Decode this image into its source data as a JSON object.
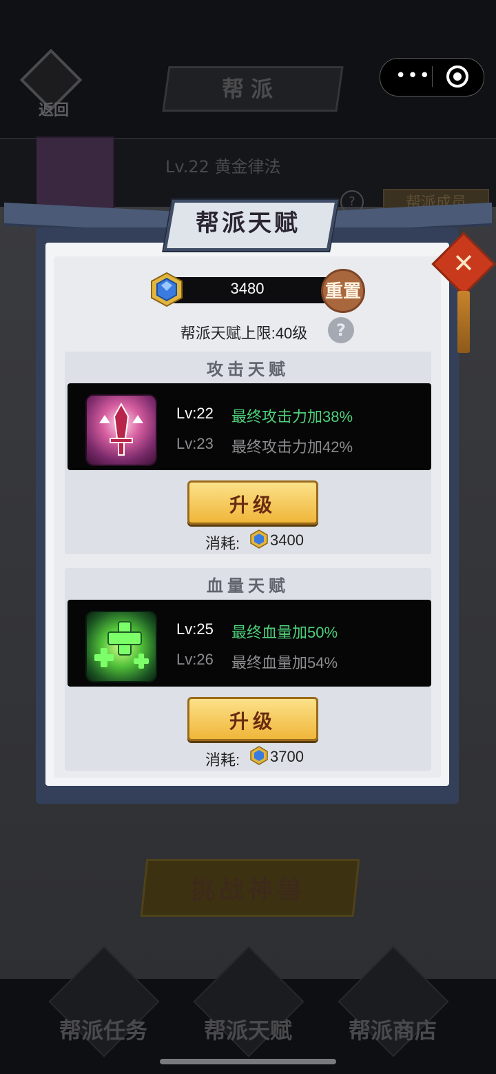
{
  "header": {
    "back_label": "返回",
    "title": "帮派",
    "menu_icon": "more-dots-icon",
    "close_icon": "target-close-icon"
  },
  "guild": {
    "name": "Lv.22  黄金律法",
    "members_label": "帮派成员"
  },
  "background": {
    "challenge_label": "挑战神兽",
    "nav": [
      "帮派任务",
      "帮派天赋",
      "帮派商店"
    ]
  },
  "dialog": {
    "title": "帮派天赋",
    "currency_value": "3480",
    "reset_label": "重置",
    "limit_text": "帮派天赋上限:40级",
    "help_label": "?",
    "close_label": "✕",
    "sections": [
      {
        "header": "攻击天赋",
        "current_level": "Lv:22",
        "current_desc": "最终攻击力加38%",
        "next_level": "Lv:23",
        "next_desc": "最终攻击力加42%",
        "upgrade_label": "升级",
        "cost_label": "消耗:",
        "cost_value": "3400",
        "icon": "sword-up-icon"
      },
      {
        "header": "血量天赋",
        "current_level": "Lv:25",
        "current_desc": "最终血量加50%",
        "next_level": "Lv:26",
        "next_desc": "最终血量加54%",
        "upgrade_label": "升级",
        "cost_label": "消耗:",
        "cost_value": "3700",
        "icon": "heal-plus-icon"
      }
    ]
  },
  "colors": {
    "accent_green": "#4fd07a",
    "gold": "#f0b63a",
    "dialog_frame": "#34405a"
  }
}
